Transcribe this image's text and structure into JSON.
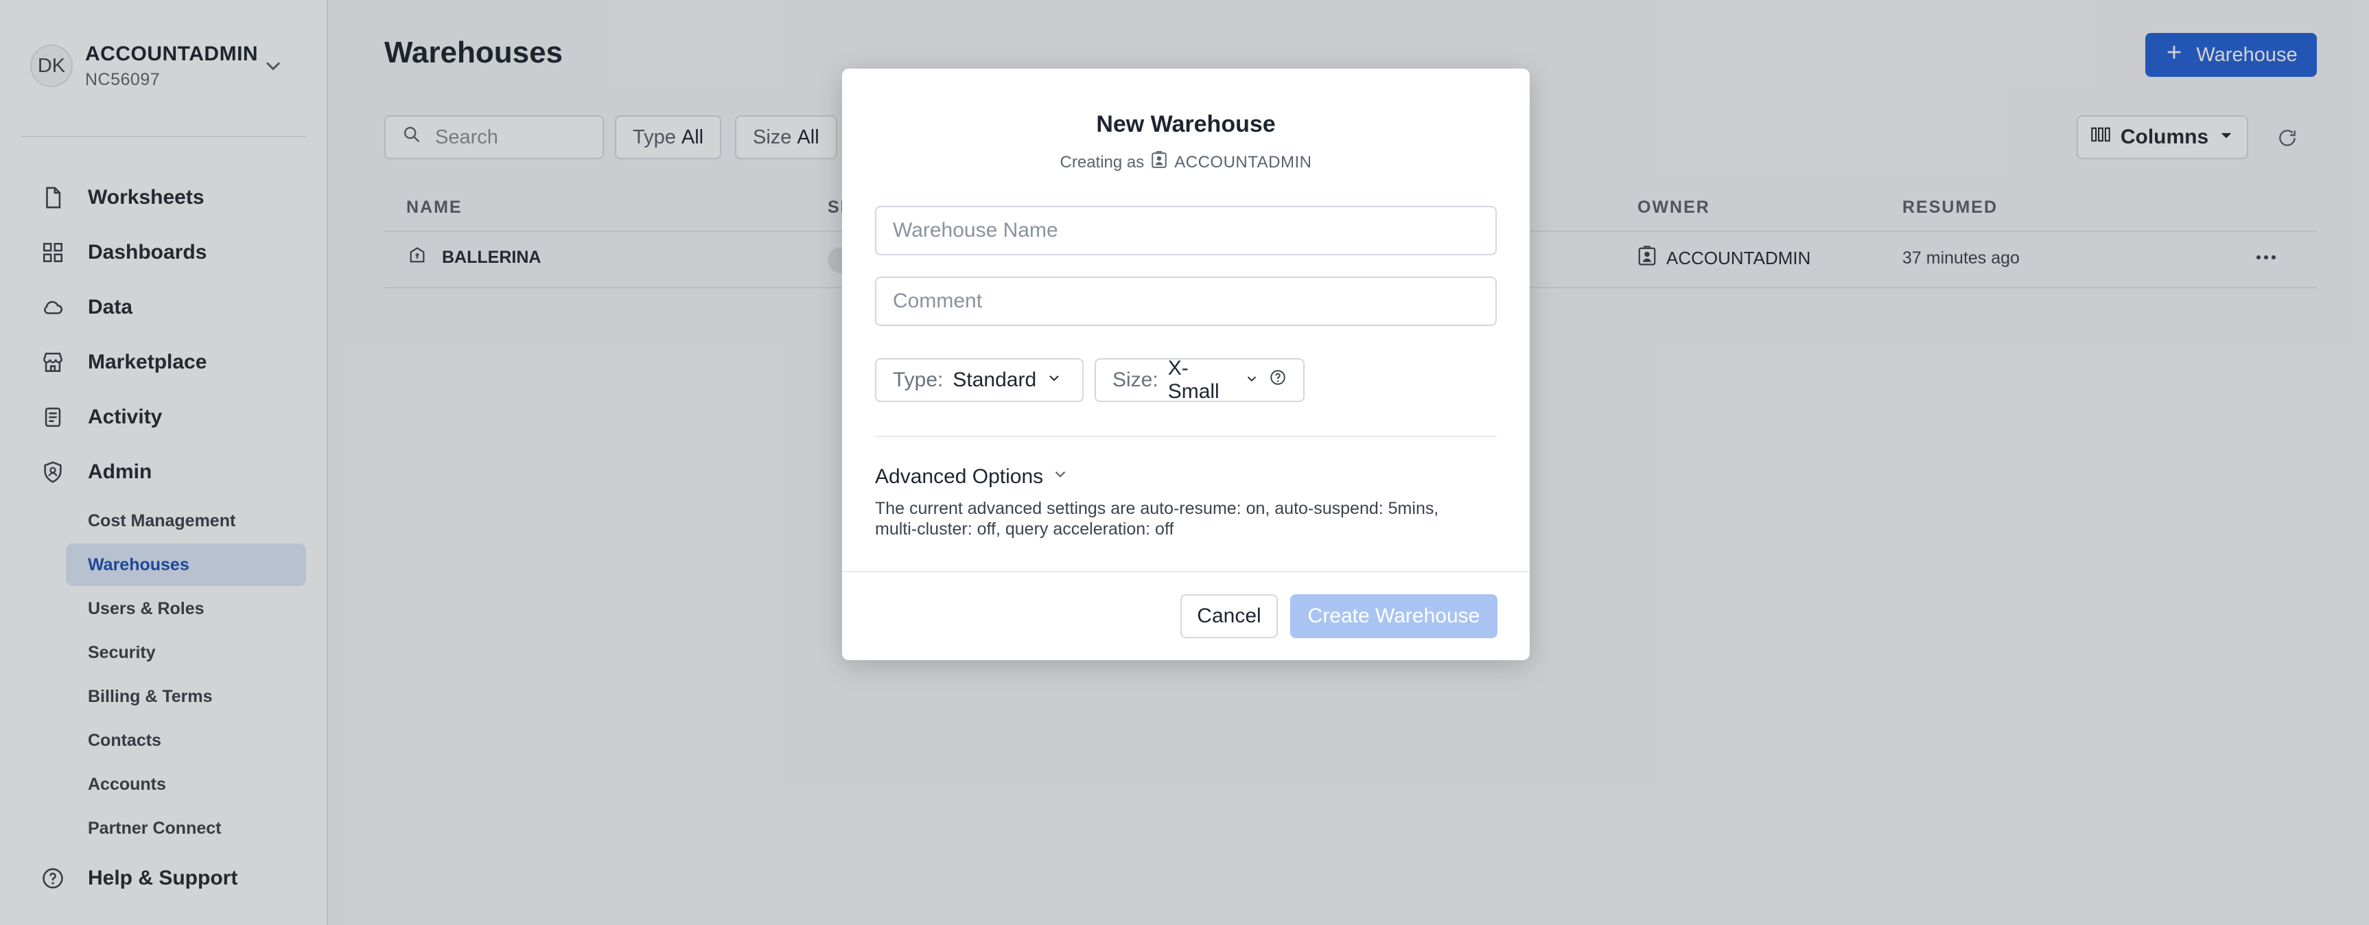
{
  "sidebar": {
    "user": {
      "initials": "DK",
      "role": "ACCOUNTADMIN",
      "account": "NC56097"
    },
    "nav": [
      {
        "label": "Worksheets",
        "icon": "document-icon"
      },
      {
        "label": "Dashboards",
        "icon": "grid-icon"
      },
      {
        "label": "Data",
        "icon": "cloud-icon"
      },
      {
        "label": "Marketplace",
        "icon": "store-icon"
      },
      {
        "label": "Activity",
        "icon": "activity-icon"
      },
      {
        "label": "Admin",
        "icon": "shield-icon"
      }
    ],
    "admin_items": [
      "Cost Management",
      "Warehouses",
      "Users & Roles",
      "Security",
      "Billing & Terms",
      "Contacts",
      "Accounts",
      "Partner Connect"
    ],
    "active_item": "Warehouses",
    "help": "Help & Support"
  },
  "main": {
    "title": "Warehouses",
    "new_button": "Warehouse",
    "search_placeholder": "Search",
    "filters": [
      {
        "key": "Type",
        "value": "All"
      },
      {
        "key": "Size",
        "value": "All"
      }
    ],
    "columns_button": "Columns",
    "table": {
      "headers": [
        "NAME",
        "SI",
        "OWNER",
        "RESUMED"
      ],
      "rows": [
        {
          "name": "BALLERINA",
          "owner": "ACCOUNTADMIN",
          "resumed": "37 minutes ago"
        }
      ]
    }
  },
  "modal": {
    "title": "New Warehouse",
    "creating_as_label": "Creating as",
    "creating_as_role": "ACCOUNTADMIN",
    "name_placeholder": "Warehouse Name",
    "comment_placeholder": "Comment",
    "type_label": "Type:",
    "type_value": "Standard",
    "size_label": "Size:",
    "size_value": "X-Small",
    "advanced_title": "Advanced Options",
    "advanced_desc_1": "The current advanced settings are auto-resume: on, auto-suspend: 5mins,",
    "advanced_desc_2": "multi-cluster: off, query acceleration: off",
    "cancel": "Cancel",
    "create": "Create Warehouse"
  },
  "colors": {
    "accent": "#2563d8",
    "active_nav_bg": "#dfe9fa",
    "disabled_button": "#a9c4f3"
  }
}
